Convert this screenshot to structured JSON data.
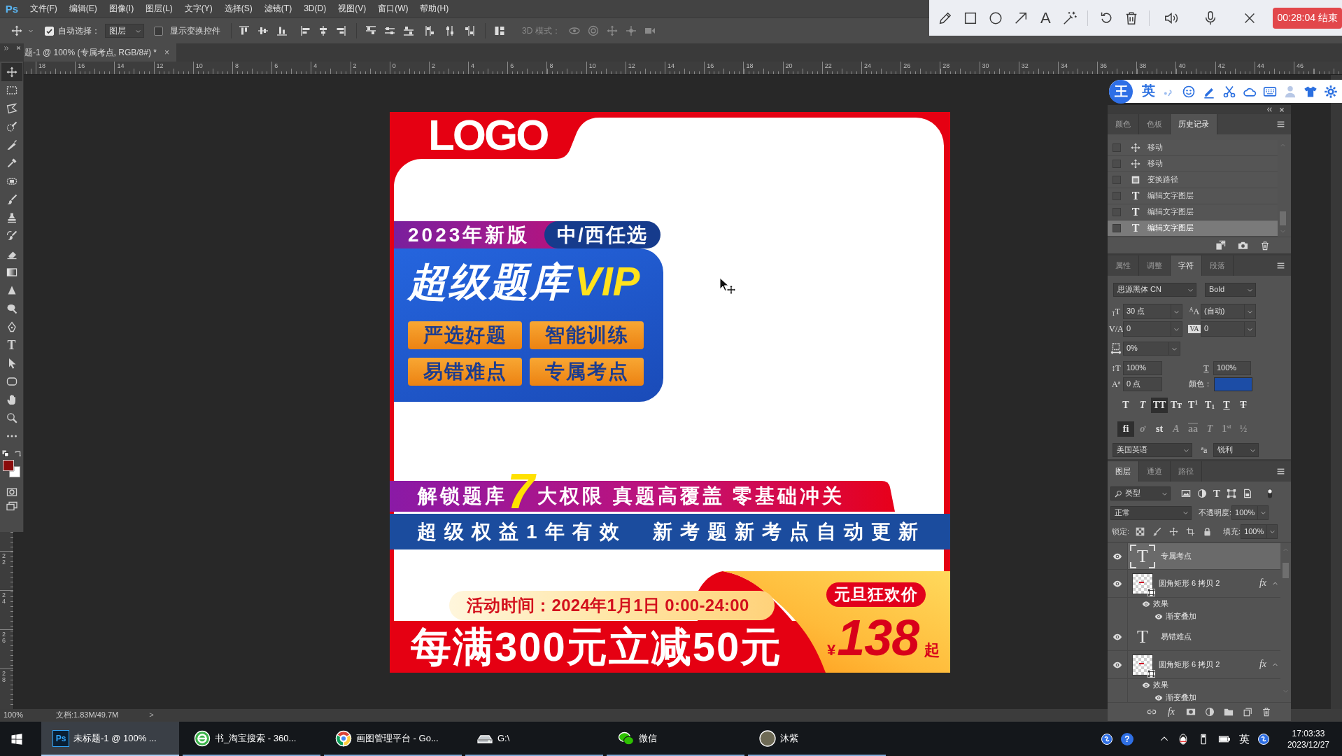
{
  "menubar": {
    "logo": "Ps",
    "items": [
      "文件(F)",
      "编辑(E)",
      "图像(I)",
      "图层(L)",
      "文字(Y)",
      "选择(S)",
      "滤镜(T)",
      "3D(D)",
      "视图(V)",
      "窗口(W)",
      "帮助(H)"
    ]
  },
  "options_bar": {
    "auto_select": {
      "label": "自动选择：",
      "checked": true
    },
    "target": "图层",
    "transform_controls": {
      "label": "显示变换控件",
      "checked": false
    },
    "mode_3d": "3D 模式："
  },
  "recorder": {
    "text_tool": "A",
    "stop_button": "00:28:04 结束"
  },
  "ime_bar": {
    "logo": "王",
    "mode": "英"
  },
  "document_tab": {
    "title": "题-1 @ 100% (专属考点, RGB/8#) *",
    "close": "×"
  },
  "rulers": {
    "horizontal": [
      "18",
      "16",
      "14",
      "12",
      "10",
      "8",
      "6",
      "4",
      "2",
      "0",
      "2",
      "4",
      "6",
      "8",
      "10",
      "12",
      "14",
      "16",
      "18",
      "20",
      "22",
      "24",
      "26",
      "28",
      "30",
      "32",
      "34",
      "36",
      "38",
      "40",
      "42",
      "44",
      "46"
    ],
    "vertical": [
      "22",
      "24",
      "26",
      "28"
    ]
  },
  "toolbar": {
    "tools": [
      {
        "kind": "move",
        "selected": true
      },
      {
        "kind": "marquee",
        "selected": false
      },
      {
        "kind": "lasso",
        "selected": false
      },
      {
        "kind": "quick_select",
        "selected": false
      },
      {
        "kind": "slice",
        "selected": false
      },
      {
        "kind": "eyedropper",
        "selected": false
      },
      {
        "kind": "healing",
        "selected": false
      },
      {
        "kind": "brush",
        "selected": false
      },
      {
        "kind": "stamp",
        "selected": false
      },
      {
        "kind": "history_brush",
        "selected": false
      },
      {
        "kind": "eraser",
        "selected": false
      },
      {
        "kind": "gradient",
        "selected": false
      },
      {
        "kind": "blur",
        "selected": false
      },
      {
        "kind": "dodge",
        "selected": false
      },
      {
        "kind": "pen",
        "selected": false
      },
      {
        "kind": "type",
        "glyph": "T",
        "selected": false
      },
      {
        "kind": "path_select",
        "selected": false
      },
      {
        "kind": "shape",
        "selected": false
      },
      {
        "kind": "hand",
        "selected": false
      },
      {
        "kind": "zoom",
        "selected": false
      },
      {
        "kind": "more",
        "selected": false
      }
    ],
    "swatches": [
      {
        "kind": "foreground",
        "color": "#8a0b0b"
      },
      {
        "kind": "background",
        "color": "#ffffff"
      }
    ]
  },
  "poster": {
    "logo": "LOGO",
    "edition": "2023年新版",
    "choice": "中/西任选",
    "headline": "超级题库",
    "headline_tag": "VIP",
    "features": [
      "严选好题",
      "智能训练",
      "易错难点",
      "专属考点"
    ],
    "unlock": {
      "lead": "解锁题库",
      "number": "7",
      "rest": "大权限 真题高覆盖 零基础冲关"
    },
    "benefit": "超级权益1年有效  新考题新考点自动更新",
    "event_time": "活动时间：2024年1月1日 0:00-24:00",
    "promo": "每满300元立减50元",
    "price_tag": "元旦狂欢价",
    "currency": "¥",
    "price": "138",
    "price_suffix": "起"
  },
  "panels": {
    "history": {
      "tabs": [
        {
          "label": "颜色",
          "selected": false
        },
        {
          "label": "色板",
          "selected": false
        },
        {
          "label": "历史记录",
          "selected": true
        }
      ],
      "items": [
        {
          "kind": "move",
          "label": "移动",
          "selected": false
        },
        {
          "kind": "move",
          "label": "移动",
          "selected": false
        },
        {
          "kind": "path",
          "label": "变换路径",
          "selected": false
        },
        {
          "kind": "text",
          "glyph": "T",
          "label": "编辑文字图层",
          "selected": false
        },
        {
          "kind": "text",
          "glyph": "T",
          "label": "编辑文字图层",
          "selected": false
        },
        {
          "kind": "text",
          "glyph": "T",
          "label": "编辑文字图层",
          "selected": true
        }
      ]
    },
    "character": {
      "tabs": [
        {
          "label": "属性",
          "selected": false
        },
        {
          "label": "调整",
          "selected": false
        },
        {
          "label": "字符",
          "selected": true
        },
        {
          "label": "段落",
          "selected": false
        }
      ],
      "font_family": "思源黑体 CN",
      "font_style": "Bold",
      "size": {
        "icon": "$_{T}$T",
        "value": "30 点"
      },
      "leading": {
        "icon": "$^{A}$A",
        "value": "(自动)"
      },
      "kerning": {
        "icon": "V/A",
        "value": "0"
      },
      "tracking": {
        "icon": "VA",
        "value": "0"
      },
      "tsume": {
        "value": "0%"
      },
      "vertical_scale": {
        "icon": "↕T",
        "value": "100%"
      },
      "horizontal_scale": {
        "icon": "T",
        "value": "100%"
      },
      "baseline_shift": {
        "icon": "A$^{a}$",
        "value": "0 点"
      },
      "color": {
        "label": "颜色：",
        "color": "#1c4da6"
      },
      "style_buttons": [
        {
          "kind": "bold",
          "label": "T",
          "selected": false
        },
        {
          "kind": "italic",
          "label": "T",
          "selected": false
        },
        {
          "kind": "caps",
          "label": "TT",
          "selected": true
        },
        {
          "kind": "small_caps",
          "label": "Tт",
          "selected": false
        },
        {
          "kind": "superscript",
          "label": "T$^{1}$",
          "selected": false
        },
        {
          "kind": "subscript",
          "label": "T$_{1}$",
          "selected": false
        },
        {
          "kind": "underline",
          "label": "T",
          "selected": false
        },
        {
          "kind": "strikethrough",
          "label": "T",
          "selected": false
        }
      ],
      "opentype_buttons": [
        {
          "kind": "standard_ligatures",
          "label": "fi",
          "selected": true,
          "disabled": false
        },
        {
          "kind": "contextual",
          "label": "ơ",
          "selected": false,
          "disabled": true
        },
        {
          "kind": "discretionary",
          "label": "st",
          "selected": false,
          "disabled": false
        },
        {
          "kind": "swash",
          "label": "A",
          "selected": false,
          "disabled": true
        },
        {
          "kind": "stylistic",
          "label": "aa",
          "selected": false,
          "disabled": true
        },
        {
          "kind": "titling",
          "label": "T",
          "selected": false,
          "disabled": true
        },
        {
          "kind": "ordinals",
          "label": "1$^{st}$",
          "selected": false,
          "disabled": true
        },
        {
          "kind": "fractions",
          "label": "½",
          "selected": false,
          "disabled": true
        }
      ],
      "language": "美国英语",
      "antialias_icon": "$^{a}$a",
      "antialias": "锐利"
    },
    "layers": {
      "tabs": [
        {
          "label": "图层",
          "selected": true
        },
        {
          "label": "通道",
          "selected": false
        },
        {
          "label": "路径",
          "selected": false
        }
      ],
      "filter": {
        "label": "类型",
        "type_glyph": "T"
      },
      "blend_mode": "正常",
      "opacity_label": "不透明度:",
      "opacity": "100%",
      "lock_label": "锁定:",
      "fill_label": "填充:",
      "fill": "100%",
      "rows": [
        {
          "kind": "text",
          "glyph": "T",
          "name": "专属考点",
          "visible": true,
          "selected": true
        },
        {
          "kind": "shape",
          "name": "圆角矩形 6 拷贝 2",
          "visible": true,
          "selected": false,
          "fx": "fx",
          "expanded": true,
          "children": [
            {
              "label": "效果",
              "visible": true,
              "children": [
                {
                  "label": "渐变叠加",
                  "visible": true
                }
              ]
            }
          ]
        },
        {
          "kind": "text",
          "glyph": "T",
          "name": "易错难点",
          "visible": true,
          "selected": false
        },
        {
          "kind": "shape",
          "name": "圆角矩形 6 拷贝 2",
          "visible": true,
          "selected": false,
          "fx": "fx",
          "expanded": true,
          "children": [
            {
              "label": "效果",
              "visible": true,
              "children": [
                {
                  "label": "渐变叠加",
                  "visible": true
                }
              ]
            }
          ]
        }
      ],
      "footer_fx": "fx"
    }
  },
  "status_bar": {
    "zoom": "100%",
    "doc_info": "文档:1.83M/49.7M",
    "arrow": ">"
  },
  "taskbar": {
    "items": [
      {
        "kind": "photoshop",
        "badge": "Ps",
        "label": "未标题-1 @ 100% ...",
        "selected": true
      },
      {
        "kind": "browser360",
        "label": "书_淘宝搜索 - 360...",
        "selected": false
      },
      {
        "kind": "chrome",
        "label": "画图管理平台 - Go...",
        "selected": false
      },
      {
        "kind": "drive",
        "label": "G:\\",
        "selected": false
      },
      {
        "kind": "wechat",
        "label": "微信",
        "selected": false
      },
      {
        "kind": "avatar",
        "label": "沐紫",
        "selected": false
      }
    ],
    "tray": {
      "help": "?",
      "ime": "英"
    },
    "clock": {
      "time": "17:03:33",
      "date": "2023/12/27"
    }
  }
}
